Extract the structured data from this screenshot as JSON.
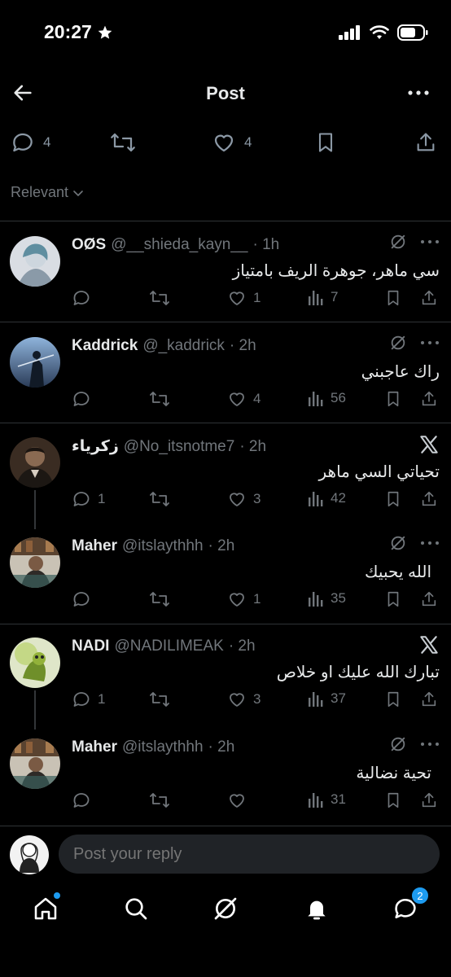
{
  "status": {
    "time": "20:27"
  },
  "header": {
    "title": "Post"
  },
  "post_actions": {
    "replies": "4",
    "likes": "4"
  },
  "sort": {
    "label": "Relevant"
  },
  "replies": [
    {
      "name": "OØS",
      "handle": "@__shieda_kayn__",
      "time": "· 1h",
      "text": "سي ماهر، جوهرة الريف بامتياز",
      "replies": "",
      "likes": "1",
      "views": "7",
      "badge": "grok"
    },
    {
      "name": "Kaddrick",
      "handle": "@_kaddrick",
      "time": "· 2h",
      "text": "راك عاجبني",
      "replies": "",
      "likes": "4",
      "views": "56",
      "badge": "grok"
    },
    {
      "name": "زكرياء",
      "handle": "@No_itsnotme7",
      "time": "· 2h",
      "text": "تحياتي السي ماهر",
      "replies": "1",
      "likes": "3",
      "views": "42",
      "badge": "x"
    },
    {
      "name": "Maher",
      "handle": "@itslaythhh",
      "time": "· 2h",
      "text": "الله يحبيك",
      "replies": "",
      "likes": "1",
      "views": "35",
      "badge": "grok"
    },
    {
      "name": "NADI",
      "handle": "@NADILIMEAK",
      "time": "· 2h",
      "text": "تبارك الله عليك او خلاص",
      "replies": "1",
      "likes": "3",
      "views": "37",
      "badge": "x"
    },
    {
      "name": "Maher",
      "handle": "@itslaythhh",
      "time": "· 2h",
      "text": "تحية نضالية",
      "replies": "",
      "likes": "",
      "views": "31",
      "badge": "grok"
    }
  ],
  "reply_box": {
    "placeholder": "Post your reply"
  },
  "tabbar": {
    "messages_badge": "2"
  },
  "colors": {
    "accent": "#1d9bf0",
    "background": "#000000",
    "muted": "#71767b"
  }
}
